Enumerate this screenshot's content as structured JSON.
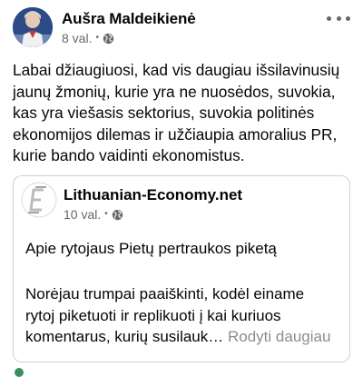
{
  "post": {
    "author": "Aušra Maldeikienė",
    "time": "8 val.",
    "separator": "•",
    "privacy_icon": "globe-icon",
    "more_icon": "more-options-icon",
    "text_lines": [
      "Labai džiaugiuosi, kad vis daugiau išsilavinusių",
      "jaunų žmonių, kurie yra ne nuosėdos, suvokia,",
      "kas yra viešasis sektorius, suvokia politinės",
      "ekonomijos dilemas ir užčiaupia amoralius PR,",
      "kurie bando vaidinti ekonomistus."
    ]
  },
  "shared": {
    "page_name": "Lithuanian-Economy.net",
    "time": "10 val.",
    "separator": "•",
    "logo_icon": "lithuanian-economy-logo-icon",
    "title": "Apie rytojaus Pietų pertraukos piketą",
    "body_lines": [
      "Norėjau trumpai paaiškinti, kodėl einame",
      "rytoj piketuoti ir replikuoti į kai kuriuos",
      "komentarus, kurių susilauk…"
    ],
    "see_more": "Rodyti daugiau"
  },
  "colors": {
    "text": "#050505",
    "secondary": "#65676b",
    "border": "#ccd0d5",
    "see_more": "#8a8d91"
  }
}
